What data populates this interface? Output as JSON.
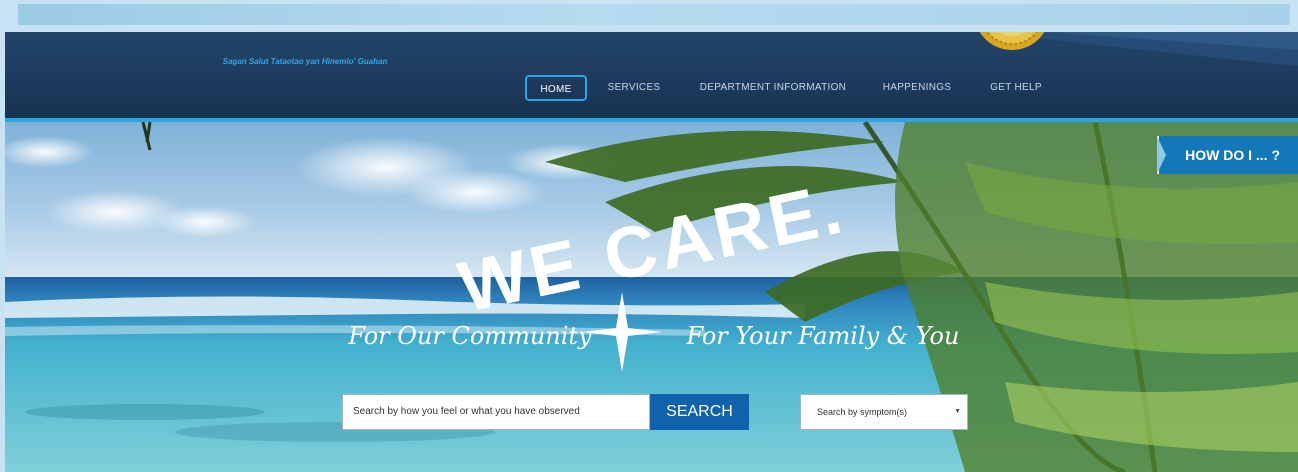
{
  "header": {
    "tagline": "Sagan Salut Tataotao yan Hinemlo' Guahan"
  },
  "nav": {
    "items": [
      {
        "label": "HOME",
        "active": true
      },
      {
        "label": "SERVICES",
        "active": false
      },
      {
        "label": "DEPARTMENT INFORMATION",
        "active": false
      },
      {
        "label": "HAPPENINGS",
        "active": false
      },
      {
        "label": "GET HELP",
        "active": false
      }
    ]
  },
  "hero": {
    "headline": "WE CARE.",
    "left_script": "For Our Community",
    "right_script": "For Your Family & You",
    "how_do_i": "HOW DO I ... ?"
  },
  "search": {
    "value": "Search by how you feel or what you have observed",
    "button_label": "SEARCH",
    "symptom_select": "Search by symptom(s)"
  },
  "colors": {
    "header_bg": "#1d3b5e",
    "accent_blue": "#2aa6e0",
    "search_button": "#1062ad",
    "how_do_i_bg": "#1477b7"
  }
}
